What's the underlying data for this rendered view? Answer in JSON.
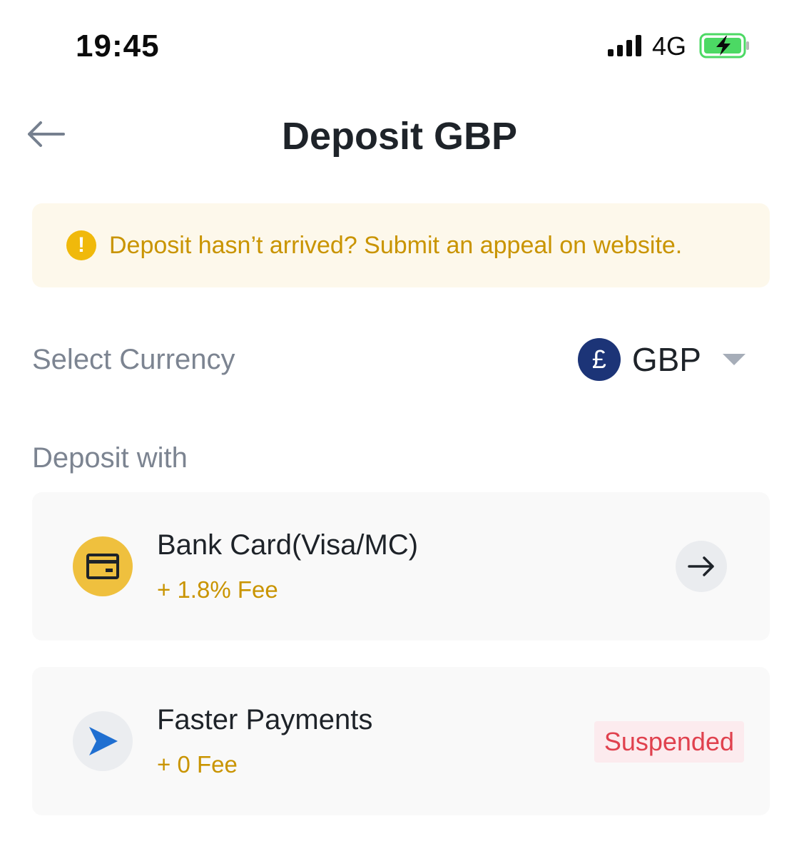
{
  "status_bar": {
    "time": "19:45",
    "network": "4G",
    "battery_charging": true,
    "battery_level": 0.8
  },
  "header": {
    "title": "Deposit GBP",
    "back_icon": "arrow-left-icon"
  },
  "banner": {
    "icon": "exclamation-icon",
    "text": "Deposit hasn’t arrived? Submit an appeal on website."
  },
  "currency": {
    "label": "Select Currency",
    "symbol": "£",
    "code": "GBP"
  },
  "deposit_with": {
    "label": "Deposit with",
    "methods": [
      {
        "name": "Bank Card(Visa/MC)",
        "fee": "+ 1.8% Fee",
        "icon": "credit-card-icon",
        "action_icon": "arrow-right-icon"
      },
      {
        "name": "Faster Payments",
        "fee": "+ 0 Fee",
        "icon": "send-icon",
        "status": "Suspended"
      }
    ]
  },
  "colors": {
    "accent": "#f0b90b",
    "fee": "#c99400",
    "suspended": "#e0414e",
    "gbp_badge": "#1c3477"
  }
}
